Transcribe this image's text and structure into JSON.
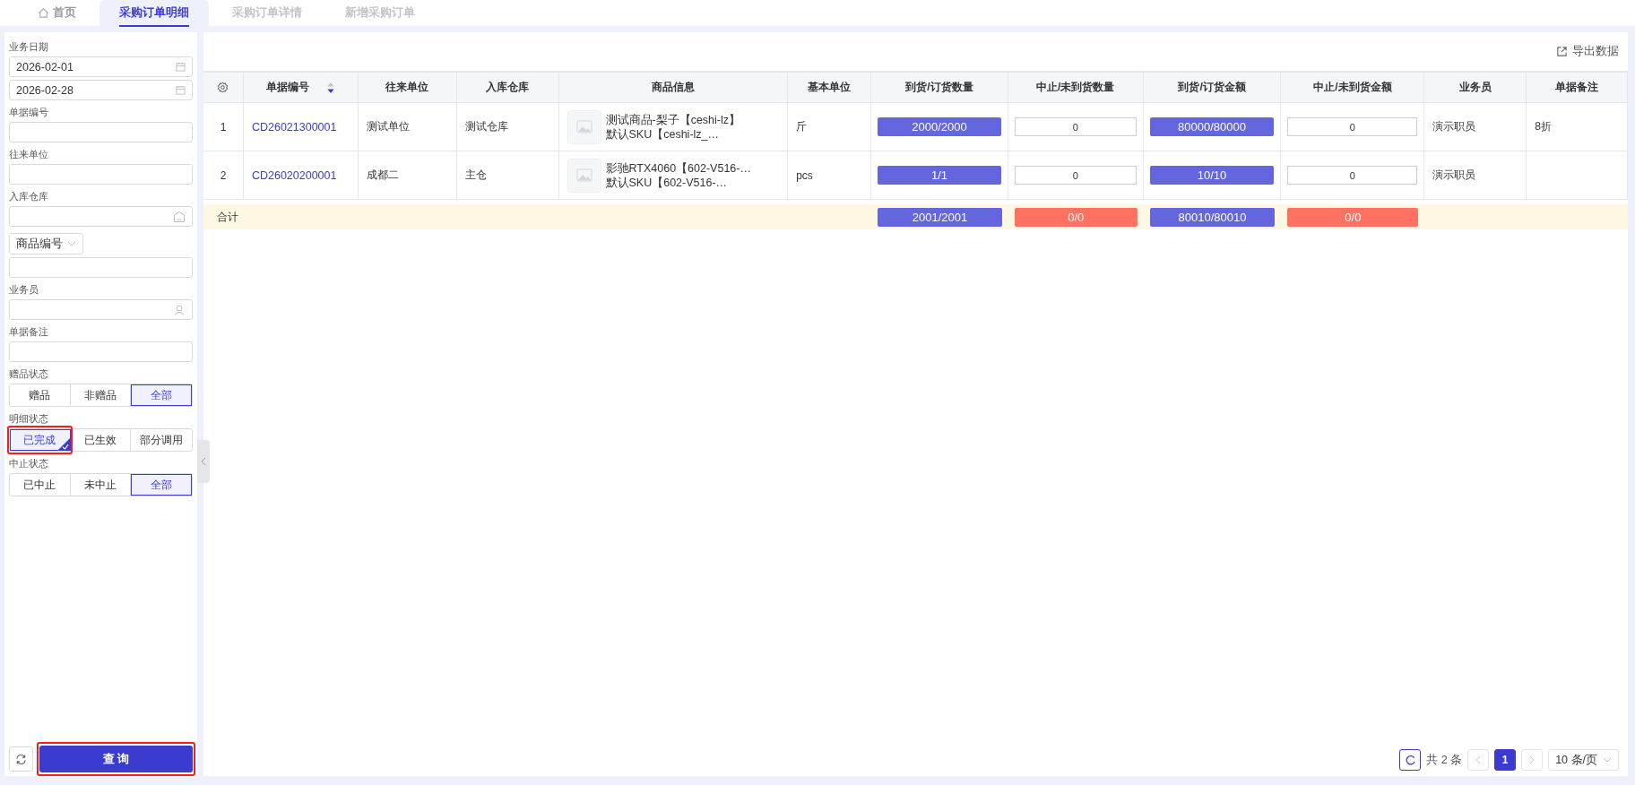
{
  "tabs": [
    {
      "label": "首页",
      "kind": "home",
      "selected": false,
      "disabled": false
    },
    {
      "label": "采购订单明细",
      "selected": true,
      "disabled": false
    },
    {
      "label": "采购订单详情",
      "selected": false,
      "disabled": true
    },
    {
      "label": "新增采购订单",
      "selected": false,
      "disabled": true
    }
  ],
  "filters": [
    {
      "kind": "label",
      "text": "业务日期"
    },
    {
      "kind": "date",
      "value": "2026-02-01"
    },
    {
      "kind": "date",
      "value": "2026-02-28"
    },
    {
      "kind": "label",
      "text": "单据编号"
    },
    {
      "kind": "input"
    },
    {
      "kind": "label",
      "text": "往来单位"
    },
    {
      "kind": "input"
    },
    {
      "kind": "label",
      "text": "入库仓库"
    },
    {
      "kind": "warehouse"
    },
    {
      "kind": "select",
      "value": "商品编号"
    },
    {
      "kind": "input"
    },
    {
      "kind": "label",
      "text": "业务员"
    },
    {
      "kind": "person"
    },
    {
      "kind": "label",
      "text": "单据备注"
    },
    {
      "kind": "input"
    },
    {
      "kind": "label",
      "text": "赠品状态"
    },
    {
      "kind": "segments",
      "multi": false,
      "options": [
        {
          "label": "赠品",
          "selected": false,
          "highlighted": false
        },
        {
          "label": "非赠品",
          "selected": false,
          "highlighted": false
        },
        {
          "label": "全部",
          "selected": true,
          "highlighted": false
        }
      ]
    },
    {
      "kind": "label",
      "text": "明细状态"
    },
    {
      "kind": "segments",
      "multi": true,
      "options": [
        {
          "label": "已完成",
          "selected": true,
          "highlighted": true
        },
        {
          "label": "已生效",
          "selected": false,
          "highlighted": false
        },
        {
          "label": "部分调用",
          "selected": false,
          "highlighted": false
        }
      ]
    },
    {
      "kind": "label",
      "text": "中止状态"
    },
    {
      "kind": "segments",
      "multi": false,
      "options": [
        {
          "label": "已中止",
          "selected": false,
          "highlighted": false
        },
        {
          "label": "未中止",
          "selected": false,
          "highlighted": false
        },
        {
          "label": "全部",
          "selected": true,
          "highlighted": false
        }
      ]
    }
  ],
  "query_button": {
    "label": "查 询",
    "highlighted": true
  },
  "export_link": "导出数据",
  "table": {
    "columns": [
      {
        "label": "单据编号",
        "sortable": true
      },
      {
        "label": "往来单位",
        "sortable": false
      },
      {
        "label": "入库仓库",
        "sortable": false
      },
      {
        "label": "商品信息",
        "sortable": false
      },
      {
        "label": "基本单位",
        "sortable": false
      },
      {
        "label": "到货/订货数量",
        "sortable": false
      },
      {
        "label": "中止/未到货数量",
        "sortable": false
      },
      {
        "label": "到货/订货金额",
        "sortable": false
      },
      {
        "label": "中止/未到货金额",
        "sortable": false
      },
      {
        "label": "业务员",
        "sortable": false
      },
      {
        "label": "单据备注",
        "sortable": false
      }
    ],
    "rows": [
      {
        "index": "1",
        "cells": [
          {
            "kind": "link",
            "text": "CD26021300001"
          },
          {
            "kind": "text",
            "text": "测试单位"
          },
          {
            "kind": "text",
            "text": "测试仓库"
          },
          {
            "kind": "product",
            "lines": [
              "测试商品-梨子【ceshi-lz】",
              "默认SKU【ceshi-lz_…"
            ]
          },
          {
            "kind": "text",
            "text": "斤"
          },
          {
            "kind": "bar",
            "text": "2000/2000"
          },
          {
            "kind": "input",
            "text": "0"
          },
          {
            "kind": "bar",
            "text": "80000/80000"
          },
          {
            "kind": "input",
            "text": "0"
          },
          {
            "kind": "text",
            "text": "演示职员"
          },
          {
            "kind": "text",
            "text": "8折"
          }
        ]
      },
      {
        "index": "2",
        "cells": [
          {
            "kind": "link",
            "text": "CD26020200001"
          },
          {
            "kind": "text",
            "text": "成都二"
          },
          {
            "kind": "text",
            "text": "主仓"
          },
          {
            "kind": "product",
            "lines": [
              "影驰RTX4060【602-V516-…",
              "默认SKU【602-V516-…"
            ]
          },
          {
            "kind": "text",
            "text": "pcs"
          },
          {
            "kind": "bar",
            "text": "1/1"
          },
          {
            "kind": "input",
            "text": "0"
          },
          {
            "kind": "bar",
            "text": "10/10"
          },
          {
            "kind": "input",
            "text": "0"
          },
          {
            "kind": "text",
            "text": "演示职员"
          },
          {
            "kind": "empty"
          }
        ]
      }
    ],
    "total": {
      "label": "合计",
      "values": [
        {
          "text": "2001/2001",
          "color": "#6366dd"
        },
        {
          "text": "0/0",
          "color": "#ff7262"
        },
        {
          "text": "80010/80010",
          "color": "#6366dd"
        },
        {
          "text": "0/0",
          "color": "#ff7262"
        }
      ]
    }
  },
  "pager": {
    "total": "共 2 条",
    "pages": [
      {
        "label": "1",
        "selected": true
      }
    ],
    "page_size": "10 条/页"
  }
}
